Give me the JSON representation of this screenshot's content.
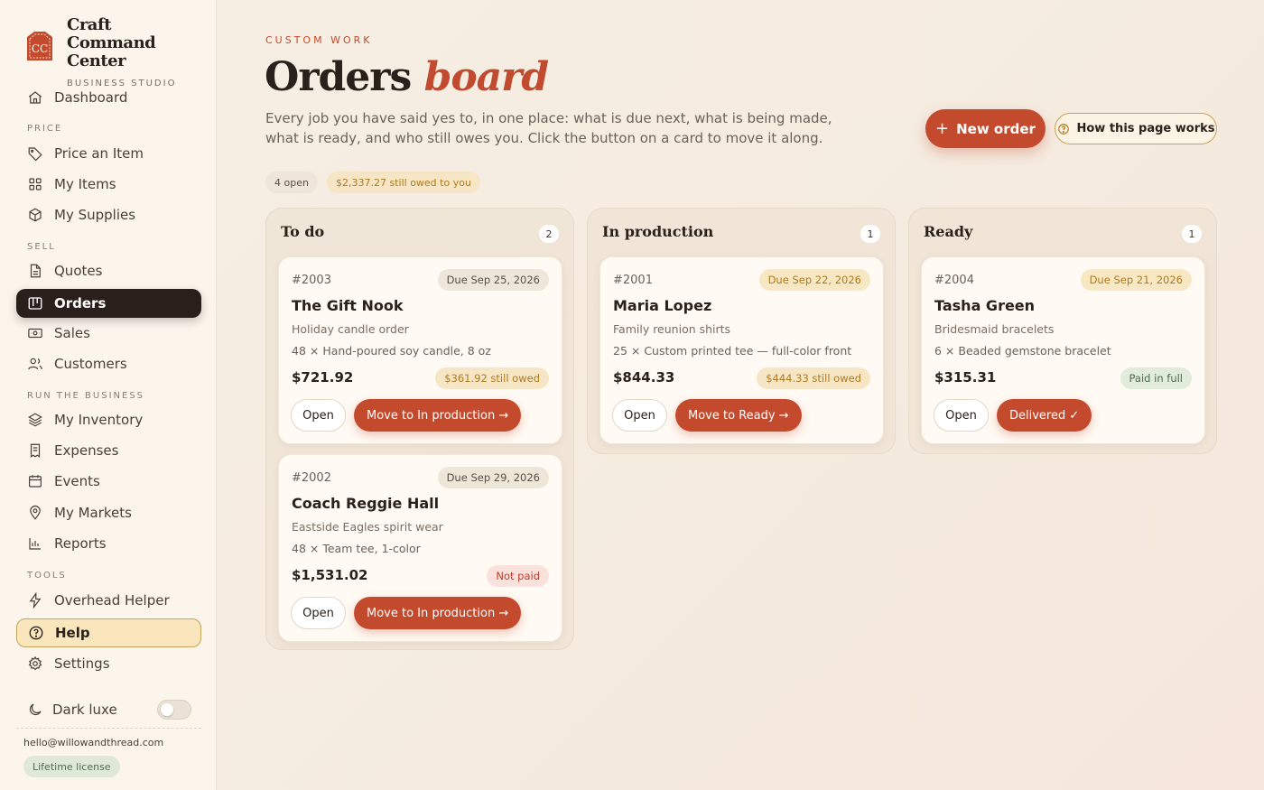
{
  "brand": {
    "name": "Craft Command Center",
    "sub": "BUSINESS STUDIO",
    "logo_text": "CC"
  },
  "sidebar": {
    "dashboard": "Dashboard",
    "section_price": "PRICE",
    "price_item": "Price an Item",
    "my_items": "My Items",
    "my_supplies": "My Supplies",
    "section_sell": "SELL",
    "quotes": "Quotes",
    "orders": "Orders",
    "sales": "Sales",
    "customers": "Customers",
    "section_run": "RUN THE BUSINESS",
    "inventory": "My Inventory",
    "expenses": "Expenses",
    "events": "Events",
    "markets": "My Markets",
    "reports": "Reports",
    "section_tools": "TOOLS",
    "overhead": "Overhead Helper",
    "help": "Help",
    "settings": "Settings",
    "dark_luxe": "Dark luxe",
    "email": "hello@willowandthread.com",
    "license": "Lifetime license"
  },
  "header": {
    "eyebrow": "CUSTOM WORK",
    "title_main": "Orders",
    "title_accent": "board",
    "subtitle": "Every job you have said yes to, in one place: what is due next, what is being made, what is ready, and who still owes you. Click the button on a card to move it along.",
    "new_order": "New order",
    "new_order_plus": "+",
    "how_it_works": "How this page works",
    "open_count": "4 open",
    "owed_total": "$2,337.27 still owed to you"
  },
  "columns": [
    {
      "title": "To do",
      "count": "2",
      "cards": [
        {
          "number": "#2003",
          "due": "Due Sep 25, 2026",
          "customer": "The Gift Nook",
          "job": "Holiday candle order",
          "line": "48 × Hand-poured soy candle, 8 oz",
          "amount": "$721.92",
          "payment": "$361.92 still owed",
          "open": "Open",
          "action": "Move to In production →"
        },
        {
          "number": "#2002",
          "due": "Due Sep 29, 2026",
          "customer": "Coach Reggie Hall",
          "job": "Eastside Eagles spirit wear",
          "line": "48 × Team tee, 1-color",
          "amount": "$1,531.02",
          "payment": "Not paid",
          "open": "Open",
          "action": "Move to In production →"
        }
      ]
    },
    {
      "title": "In production",
      "count": "1",
      "cards": [
        {
          "number": "#2001",
          "due": "Due Sep 22, 2026",
          "customer": "Maria Lopez",
          "job": "Family reunion shirts",
          "line": "25 × Custom printed tee — full-color front",
          "amount": "$844.33",
          "payment": "$444.33 still owed",
          "open": "Open",
          "action": "Move to Ready →"
        }
      ]
    },
    {
      "title": "Ready",
      "count": "1",
      "cards": [
        {
          "number": "#2004",
          "due": "Due Sep 21, 2026",
          "customer": "Tasha Green",
          "job": "Bridesmaid bracelets",
          "line": "6 × Beaded gemstone bracelet",
          "amount": "$315.31",
          "payment": "Paid in full",
          "open": "Open",
          "action": "Delivered ✓"
        }
      ]
    }
  ],
  "colors": {
    "accent": "#c44a2e",
    "sidebar_active": "#2a1f1b",
    "gold": "#b07a1f"
  }
}
